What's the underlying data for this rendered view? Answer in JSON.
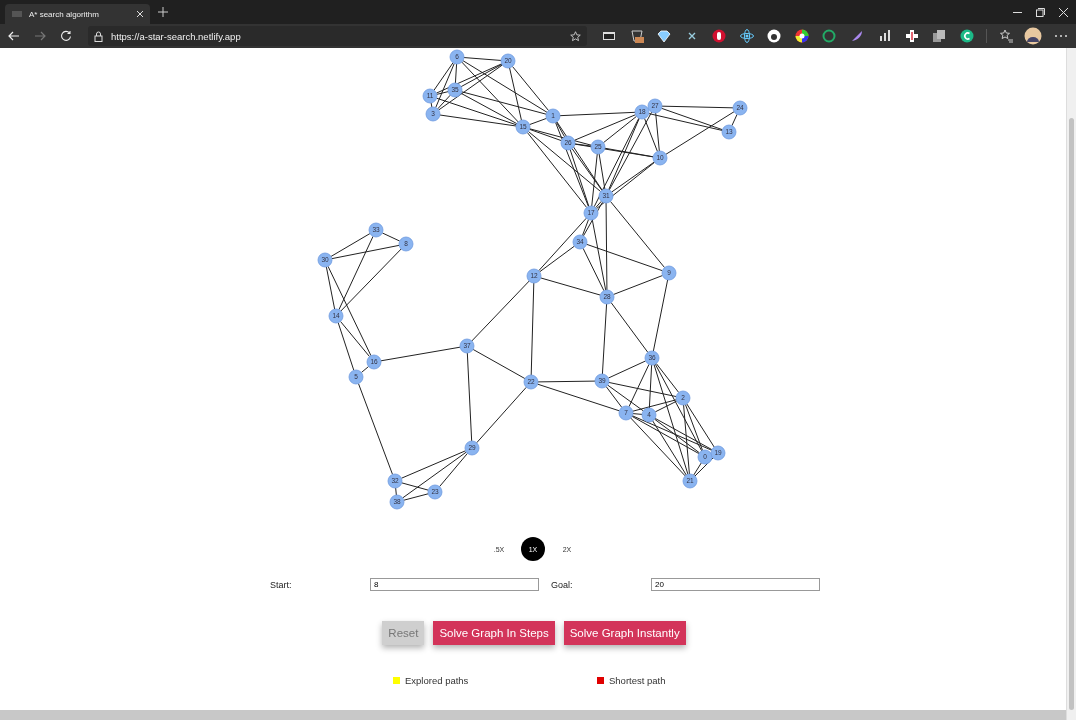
{
  "browser": {
    "tab_title": "A* search algorithm",
    "url": "https://a-star-search.netlify.app"
  },
  "graph": {
    "nodes": [
      "6",
      "20",
      "11",
      "35",
      "3",
      "1",
      "18",
      "27",
      "24",
      "13",
      "15",
      "26",
      "25",
      "10",
      "31",
      "17",
      "34",
      "33",
      "8",
      "30",
      "12",
      "9",
      "28",
      "14",
      "37",
      "16",
      "5",
      "36",
      "22",
      "39",
      "2",
      "7",
      "4",
      "29",
      "0",
      "19",
      "21",
      "32",
      "23",
      "38"
    ]
  },
  "speed_options": [
    {
      "label": ".5X",
      "selected": false
    },
    {
      "label": "1X",
      "selected": true
    },
    {
      "label": "2X",
      "selected": false
    }
  ],
  "start": {
    "label": "Start:",
    "value": "8"
  },
  "goal": {
    "label": "Goal:",
    "value": "20"
  },
  "buttons": [
    {
      "label": "Reset",
      "disabled": true
    },
    {
      "label": "Solve Graph In Steps",
      "disabled": false
    },
    {
      "label": "Solve Graph Instantly",
      "disabled": false
    }
  ],
  "legend": [
    {
      "label": "Explored paths",
      "color": "#ffff00"
    },
    {
      "label": "Shortest path",
      "color": "#e00000"
    }
  ]
}
